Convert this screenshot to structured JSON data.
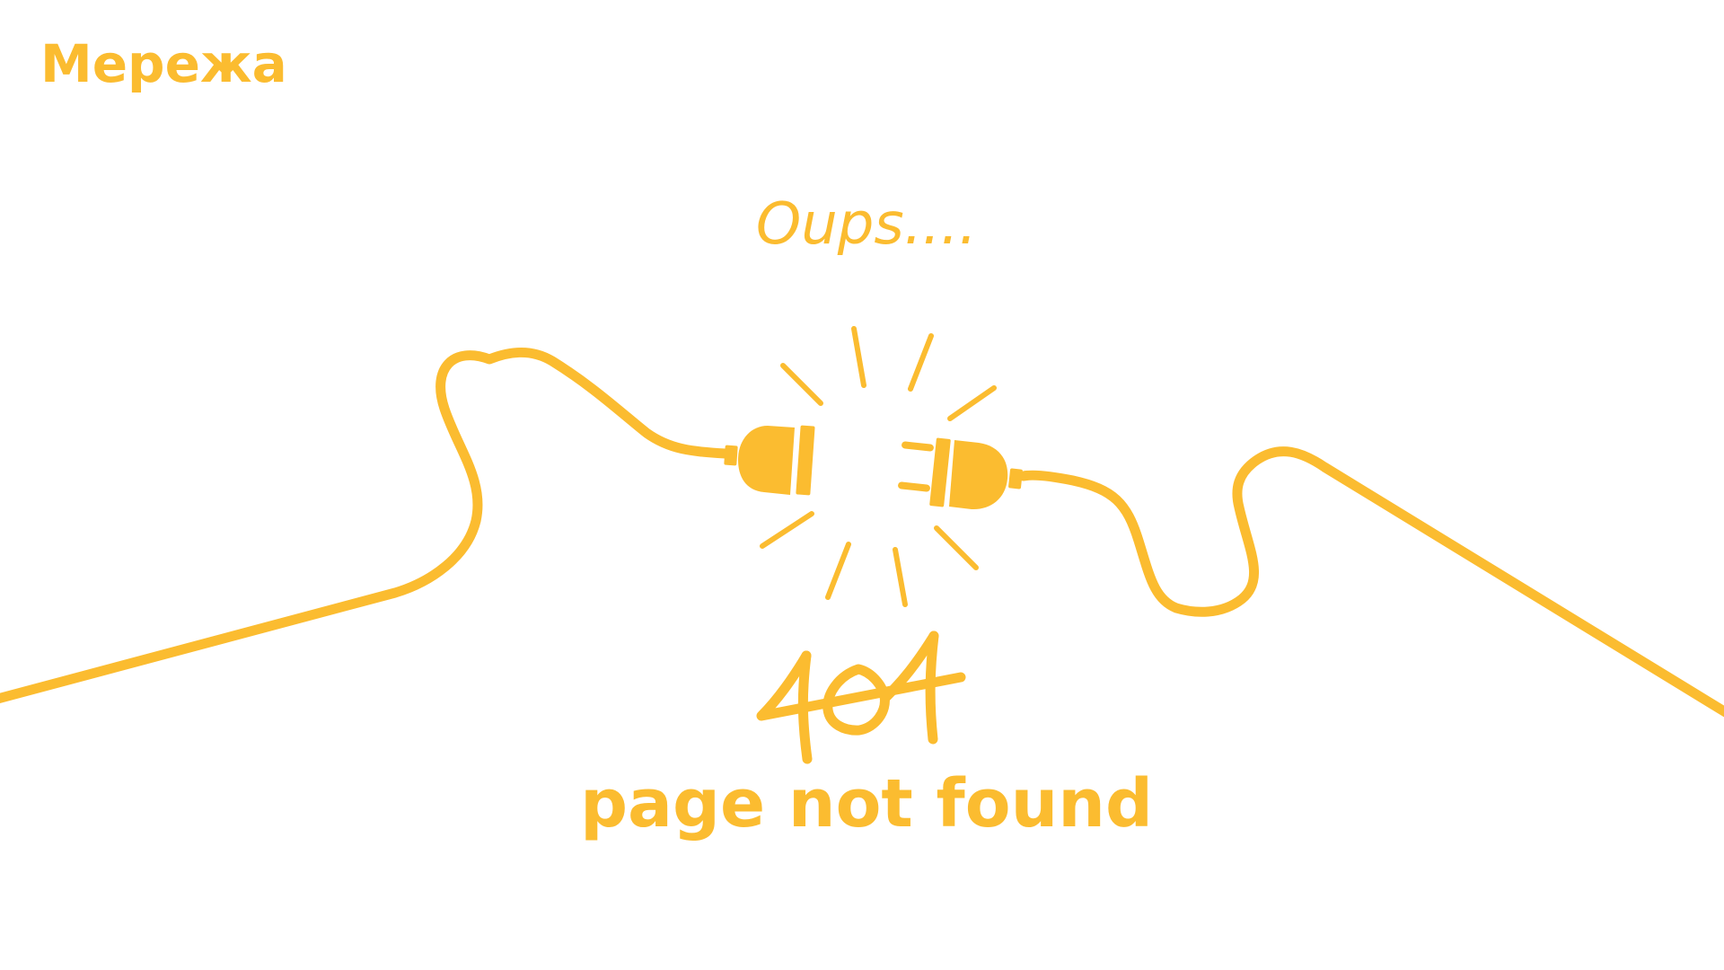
{
  "header": {
    "logo_text": "Мережа"
  },
  "error": {
    "exclamation": "Oups....",
    "code": "404",
    "message": "page not found"
  },
  "illustration": {
    "subject": "unplugged-power-cord",
    "icons": [
      "plug-icon",
      "socket-icon",
      "spark-icon"
    ]
  },
  "colors": {
    "accent": "#FBBC30",
    "background": "#FFFFFF"
  }
}
